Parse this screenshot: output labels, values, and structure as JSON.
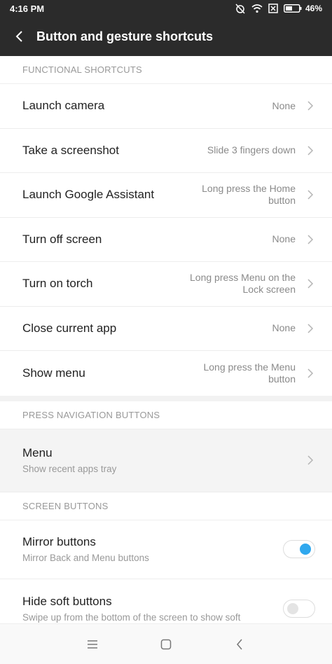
{
  "status_bar": {
    "time": "4:16 PM",
    "battery": "46%"
  },
  "header": {
    "title": "Button and gesture shortcuts"
  },
  "sections": [
    {
      "title": "FUNCTIONAL SHORTCUTS",
      "items": [
        {
          "label": "Launch camera",
          "value": "None"
        },
        {
          "label": "Take a screenshot",
          "value": "Slide 3 fingers down"
        },
        {
          "label": "Launch Google Assistant",
          "value": "Long press the Home button"
        },
        {
          "label": "Turn off screen",
          "value": "None"
        },
        {
          "label": "Turn on torch",
          "value": "Long press Menu on the Lock screen"
        },
        {
          "label": "Close current app",
          "value": "None"
        },
        {
          "label": "Show menu",
          "value": "Long press the Menu button"
        }
      ]
    },
    {
      "title": "PRESS NAVIGATION BUTTONS",
      "items": [
        {
          "label": "Menu",
          "subtitle": "Show recent apps tray"
        }
      ]
    },
    {
      "title": "SCREEN BUTTONS",
      "items": [
        {
          "label": "Mirror buttons",
          "subtitle": "Mirror Back and Menu buttons",
          "toggle": true
        },
        {
          "label": "Hide soft buttons",
          "subtitle": "Swipe up from the bottom of the screen to show soft",
          "toggle": false
        }
      ]
    }
  ],
  "colors": {
    "header_bg": "#2b2b2b",
    "toggle_on": "#30a8ee"
  },
  "icons": [
    "back-arrow-icon",
    "chevron-right-icon",
    "nav-menu-icon",
    "nav-home-icon",
    "nav-back-icon"
  ]
}
